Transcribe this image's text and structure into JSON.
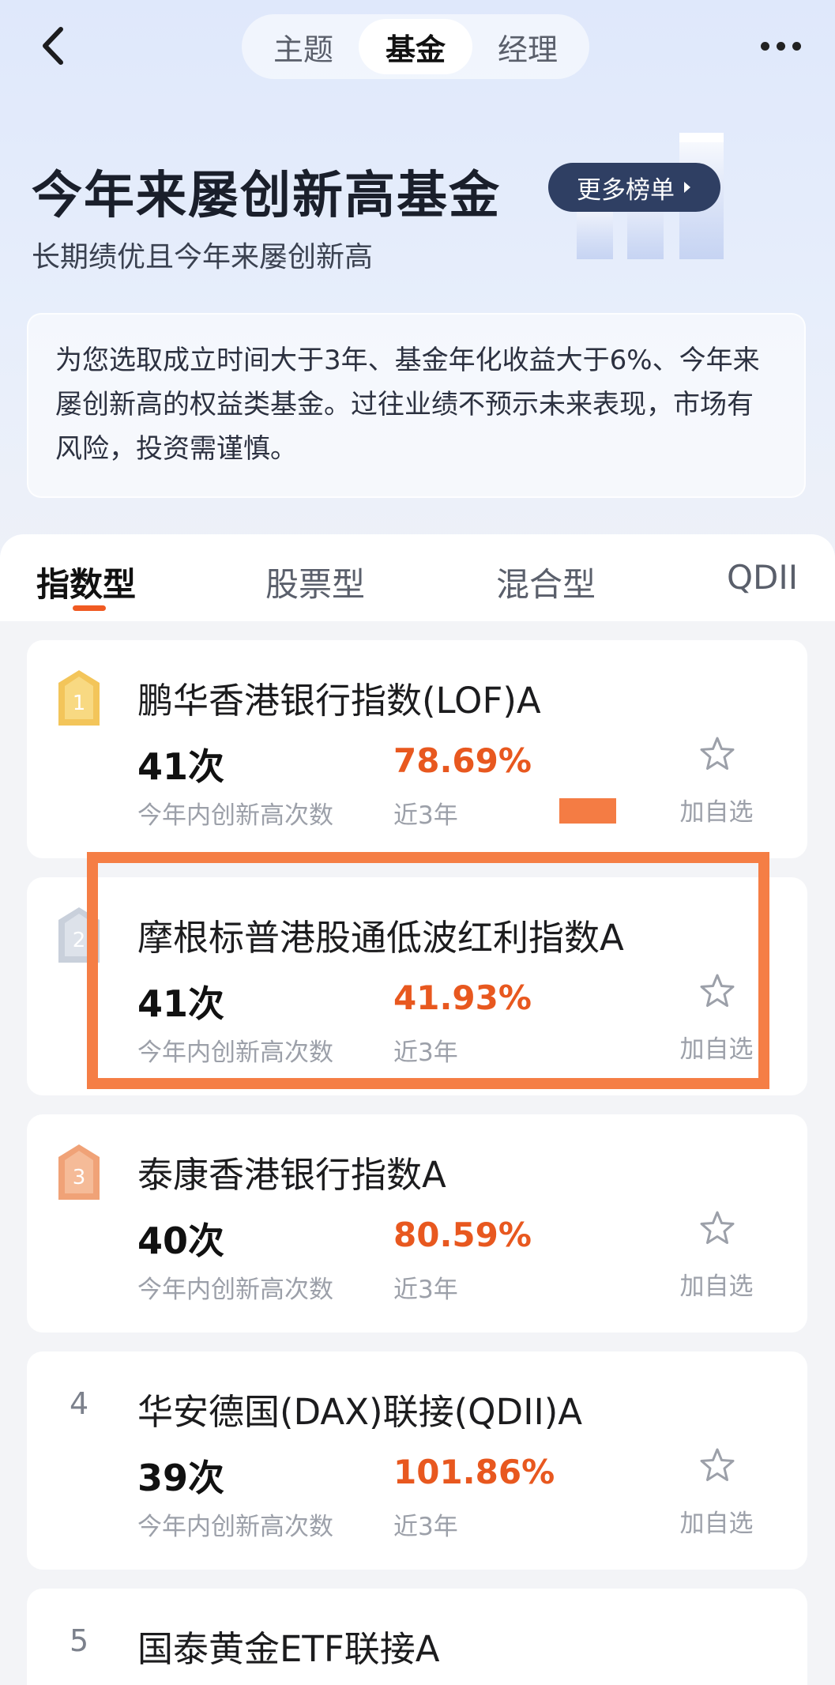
{
  "nav": {
    "tabs": [
      "主题",
      "基金",
      "经理"
    ],
    "active_tab": "基金"
  },
  "header": {
    "title": "今年来屡创新高基金",
    "more_rankings": "更多榜单",
    "subtitle": "长期绩优且今年来屡创新高"
  },
  "description": "为您选取成立时间大于3年、基金年化收益大于6%、今年来屡创新高的权益类基金。过往业绩不预示未来表现，市场有风险，投资需谨慎。",
  "category_tabs": [
    "指数型",
    "股票型",
    "混合型",
    "QDII"
  ],
  "active_category": "指数型",
  "funds": [
    {
      "rank": "1",
      "name": "鹏华香港银行指数(LOF)A",
      "count": "41次",
      "count_label": "今年内创新高次数",
      "return": "78.69%",
      "return_label": "近3年",
      "fav_label": "加自选"
    },
    {
      "rank": "2",
      "name": "摩根标普港股通低波红利指数A",
      "count": "41次",
      "count_label": "今年内创新高次数",
      "return": "41.93%",
      "return_label": "近3年",
      "fav_label": "加自选"
    },
    {
      "rank": "3",
      "name": "泰康香港银行指数A",
      "count": "40次",
      "count_label": "今年内创新高次数",
      "return": "80.59%",
      "return_label": "近3年",
      "fav_label": "加自选"
    },
    {
      "rank": "4",
      "name": "华安德国(DAX)联接(QDII)A",
      "count": "39次",
      "count_label": "今年内创新高次数",
      "return": "101.86%",
      "return_label": "近3年",
      "fav_label": "加自选"
    },
    {
      "rank": "5",
      "name": "国泰黄金ETF联接A",
      "count": "",
      "count_label": "",
      "return": "",
      "return_label": "",
      "fav_label": ""
    }
  ],
  "colors": {
    "accent": "#e8581f",
    "highlight_border": "#f57e45",
    "rank_button": "#2f3f63",
    "gold_badge": "#f3c55a",
    "silver_badge": "#c9d0db",
    "bronze_badge": "#f0a277"
  }
}
